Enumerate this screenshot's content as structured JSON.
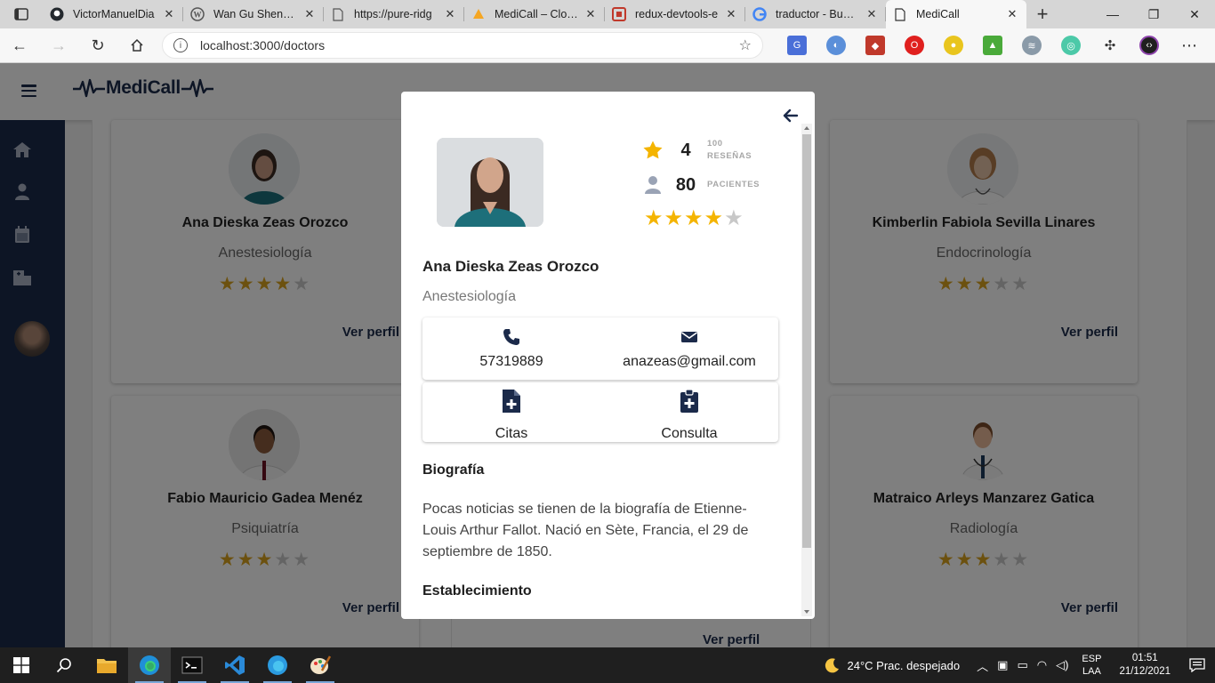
{
  "browser": {
    "tabs": [
      {
        "title": "VictorManuelDia",
        "favicon": "github-icon",
        "active": false
      },
      {
        "title": "Wan Gu Shen Wa",
        "favicon": "wordpress-icon",
        "active": false
      },
      {
        "title": "https://pure-ridg",
        "favicon": "page-icon",
        "active": false
      },
      {
        "title": "MediCall – Cloud",
        "favicon": "cloud-icon",
        "active": false
      },
      {
        "title": "redux-devtools-e",
        "favicon": "redux-icon",
        "active": false
      },
      {
        "title": "traductor - Busca",
        "favicon": "google-icon",
        "active": false
      },
      {
        "title": "MediCall",
        "favicon": "page-icon",
        "active": true
      }
    ],
    "url": "localhost:3000/doctors"
  },
  "app": {
    "logo_text": "MediCall",
    "sidebar_icons": [
      "home-icon",
      "user-doctor-icon",
      "calendar-icon",
      "hospital-icon"
    ],
    "doctors": [
      {
        "name": "Ana Dieska Zeas Orozco",
        "specialty": "Anestesiología",
        "rating": 4,
        "link": "Ver perfil"
      },
      {
        "name": "Kimberlin Fabiola Sevilla Linares",
        "specialty": "Endocrinología",
        "rating": 3,
        "link": "Ver perfil"
      },
      {
        "name": "Fabio Mauricio Gadea Menéz",
        "specialty": "Psiquiatría",
        "rating": 3,
        "link": "Ver perfil"
      },
      {
        "name": "Matraico Arleys Manzarez Gatica",
        "specialty": "Radiología",
        "rating": 3,
        "link": "Ver perfil"
      }
    ],
    "center_links": [
      "Ver perfil"
    ]
  },
  "modal": {
    "rating_value": "4",
    "reviews_count": "100",
    "reviews_label": "RESEÑAS",
    "patients_count": "80",
    "patients_label": "PACIENTES",
    "stars": 4,
    "name": "Ana Dieska Zeas Orozco",
    "specialty": "Anestesiología",
    "phone": "57319889",
    "email": "anazeas@gmail.com",
    "citas_label": "Citas",
    "consulta_label": "Consulta",
    "bio_title": "Biografía",
    "bio_text": "Pocas noticias se tienen de la biografía de Etienne-Louis Arthur Fallot. Nació en Sète, Francia, el 29 de septiembre de 1850.",
    "establishment_title": "Establecimiento"
  },
  "taskbar": {
    "weather": "24°C  Prac. despejado",
    "lang_top": "ESP",
    "lang_bottom": "LAA",
    "time": "01:51",
    "date": "21/12/2021"
  },
  "colors": {
    "navy": "#1b2a4a",
    "star": "#f4b400",
    "star_dim": "#d9a21e"
  }
}
